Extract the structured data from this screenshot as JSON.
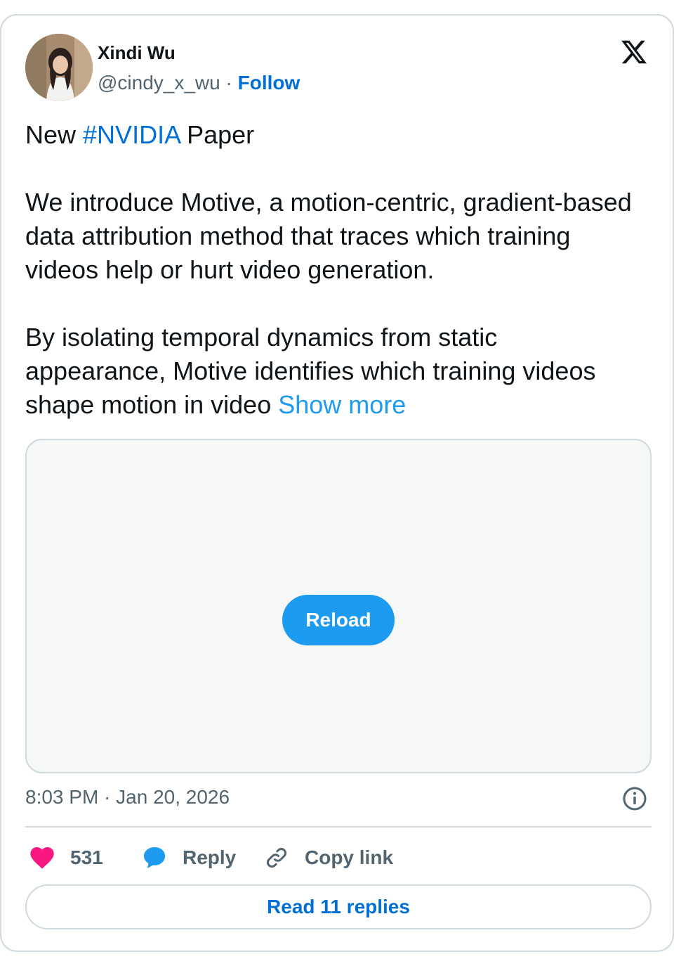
{
  "author": {
    "display_name": "Xindi Wu",
    "handle": "@cindy_x_wu",
    "separator": "·",
    "follow_label": "Follow"
  },
  "tweet": {
    "line1_prefix": "New ",
    "hashtag": "#NVIDIA",
    "line1_suffix": " Paper",
    "paragraph2": "We introduce Motive, a motion-centric, gradient-based data attribution method that traces which training videos help or hurt video generation.",
    "paragraph3": "By isolating temporal dynamics from static appearance, Motive identifies which training videos shape motion in video",
    "show_more": "Show more"
  },
  "media": {
    "reload_label": "Reload"
  },
  "timestamp": "8:03 PM · Jan 20, 2026",
  "actions": {
    "likes_count": "531",
    "reply_label": "Reply",
    "copy_link_label": "Copy link"
  },
  "read_replies_label": "Read 11 replies",
  "colors": {
    "link_blue": "#006fd6",
    "accent_blue": "#1d9bf0",
    "like_pink": "#f91880",
    "muted_gray": "#536471",
    "border": "#cfd9de"
  },
  "icons": [
    "x-logo-icon",
    "info-icon",
    "heart-icon",
    "reply-bubble-icon",
    "link-icon"
  ]
}
